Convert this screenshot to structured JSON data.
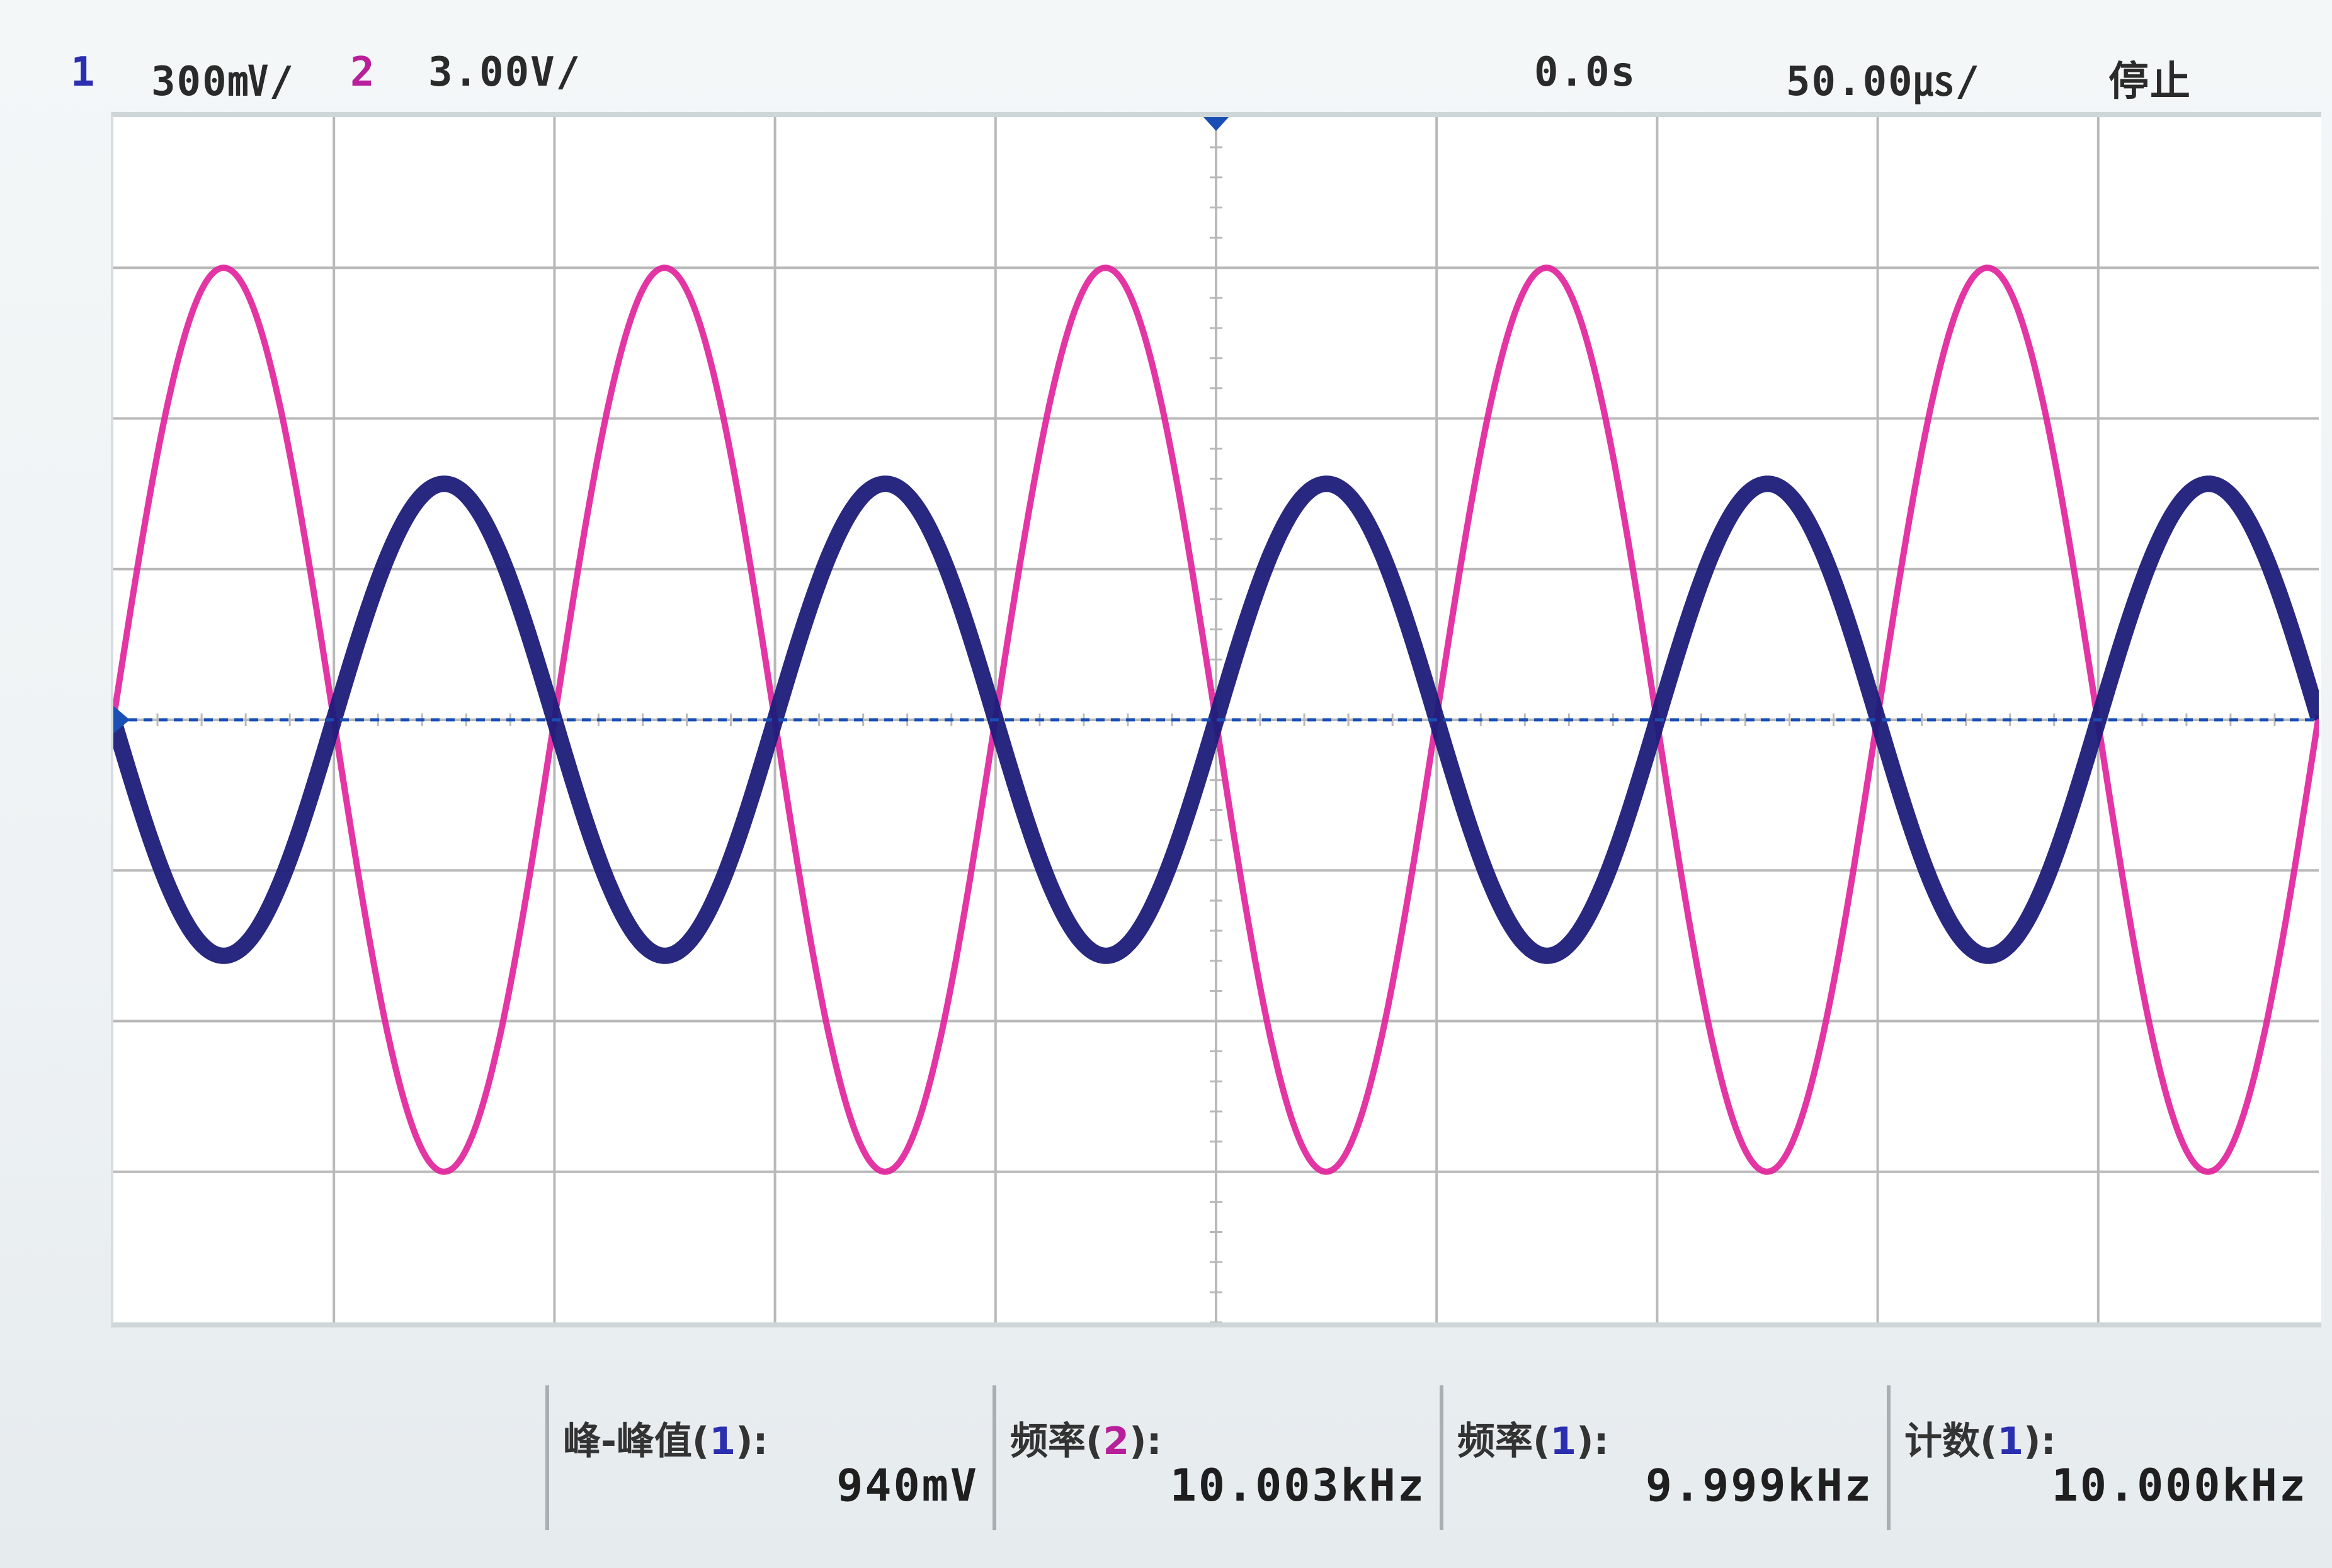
{
  "status_bar": {
    "ch1_label": "1",
    "ch1_scale": "300㎷/",
    "ch2_label": "2",
    "ch2_scale": "3.00V/",
    "time_offset": "0.0s",
    "time_scale": "50.00㎲/",
    "run_state": "停止"
  },
  "measurements": [
    {
      "label_prefix": "峰-峰值(",
      "channel": "1",
      "label_suffix": "):",
      "value": "940mV"
    },
    {
      "label_prefix": "频率(",
      "channel": "2",
      "label_suffix": "):",
      "value": "10.003kHz"
    },
    {
      "label_prefix": "频率(",
      "channel": "1",
      "label_suffix": "):",
      "value": "9.999kHz"
    },
    {
      "label_prefix": "计数(",
      "channel": "1",
      "label_suffix": "):",
      "value": "10.000kHz"
    }
  ],
  "colors": {
    "ch1": "#1c1c7a",
    "ch2": "#e0209a",
    "ground_marker": "#1a4fb5",
    "grid": "#b9b9b9"
  },
  "chart_data": {
    "type": "line",
    "grid_on": true,
    "divisions": {
      "x": 10,
      "y": 8
    },
    "time_per_div_us": 50,
    "series": [
      {
        "name": "1",
        "frequency_khz": 9.999,
        "peak_to_peak_v": 0.94,
        "volts_per_div": 0.3,
        "phase_deg": 180
      },
      {
        "name": "2",
        "frequency_khz": 10.003,
        "peak_to_peak_v": 18.0,
        "volts_per_div": 3.0,
        "phase_deg": 0
      }
    ]
  }
}
